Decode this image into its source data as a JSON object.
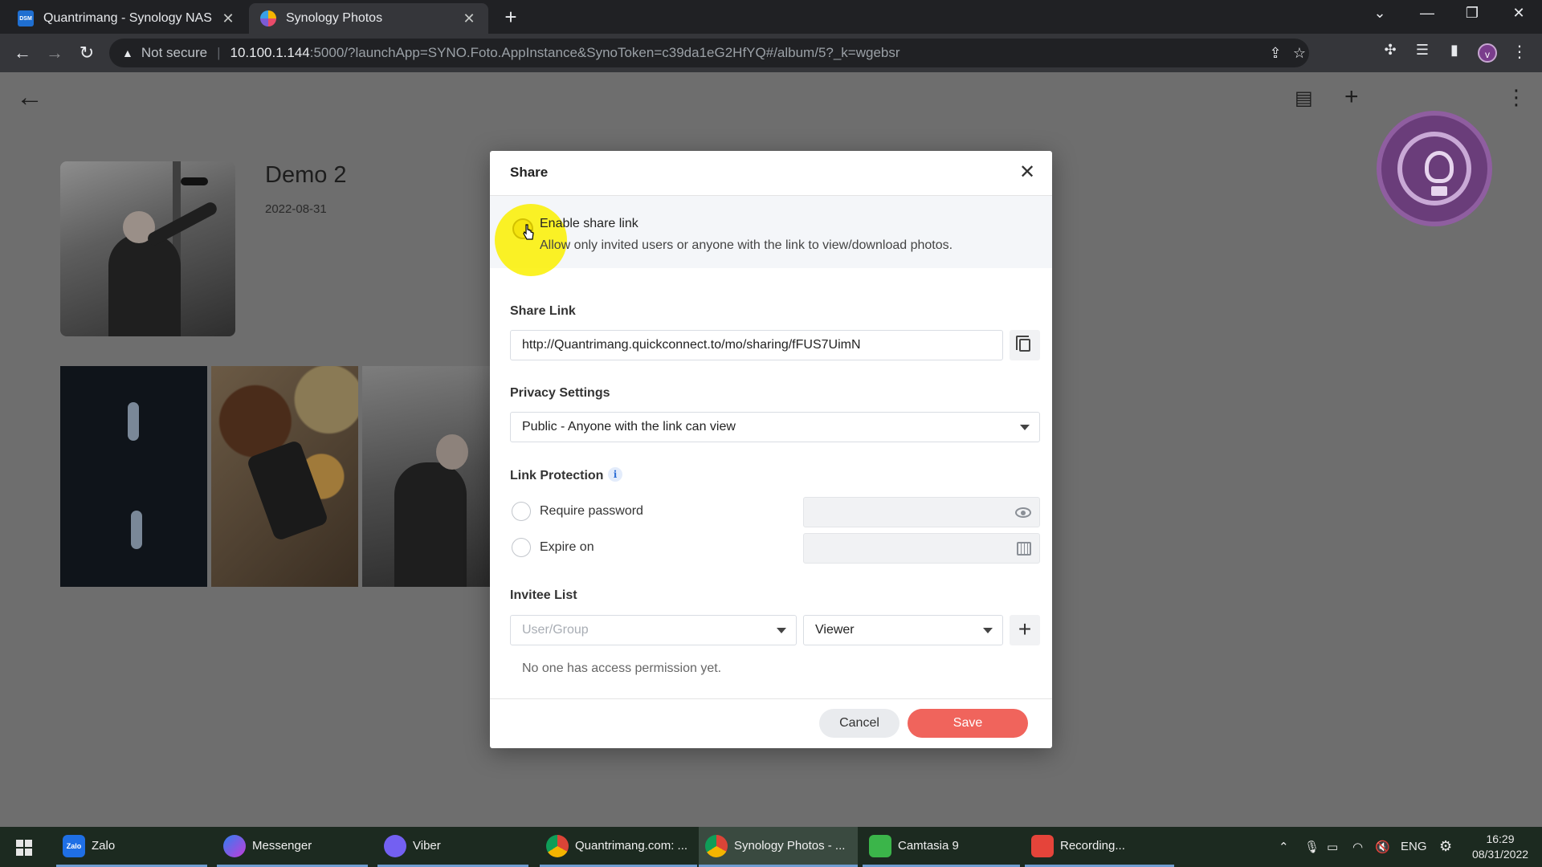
{
  "browser": {
    "tabs": [
      {
        "favicon": "DSM",
        "title": "Quantrimang - Synology NAS",
        "active": false
      },
      {
        "favicon": "synology-photos-icon",
        "title": "Synology Photos",
        "active": true
      }
    ],
    "omnibox": {
      "security": "Not secure",
      "host": "10.100.1.144",
      "path": ":5000/?launchApp=SYNO.Foto.AppInstance&SynoToken=c39da1eG2HfYQ#/album/5?_k=wgebsr"
    },
    "profile_initial": "v"
  },
  "album": {
    "title": "Demo 2",
    "date": "2022-08-31"
  },
  "share_dialog": {
    "title": "Share",
    "enable": {
      "label": "Enable share link",
      "description": "Allow only invited users or anyone with the link to view/download photos."
    },
    "share_link": {
      "label": "Share Link",
      "value": "http://Quantrimang.quickconnect.to/mo/sharing/fFUS7UimN"
    },
    "privacy": {
      "label": "Privacy Settings",
      "selected": "Public - Anyone with the link can view"
    },
    "link_protection": {
      "label": "Link Protection",
      "require_password": "Require password",
      "expire_on": "Expire on"
    },
    "invitee": {
      "label": "Invitee List",
      "user_placeholder": "User/Group",
      "role": "Viewer",
      "empty": "No one has access permission yet."
    },
    "buttons": {
      "cancel": "Cancel",
      "save": "Save"
    },
    "colors": {
      "save": "#f0645c",
      "highlight": "#faf000"
    }
  },
  "taskbar": {
    "items": [
      {
        "icon": "Zalo",
        "label": "Zalo"
      },
      {
        "icon": "messenger-icon",
        "label": "Messenger"
      },
      {
        "icon": "viber-icon",
        "label": "Viber"
      },
      {
        "icon": "chrome-icon",
        "label": "Quantrimang.com: ..."
      },
      {
        "icon": "chrome-icon",
        "label": "Synology Photos - ..."
      },
      {
        "icon": "camtasia-icon",
        "label": "Camtasia 9"
      },
      {
        "icon": "recorder-icon",
        "label": "Recording..."
      }
    ],
    "language": "ENG",
    "time": "16:29",
    "date": "08/31/2022"
  }
}
